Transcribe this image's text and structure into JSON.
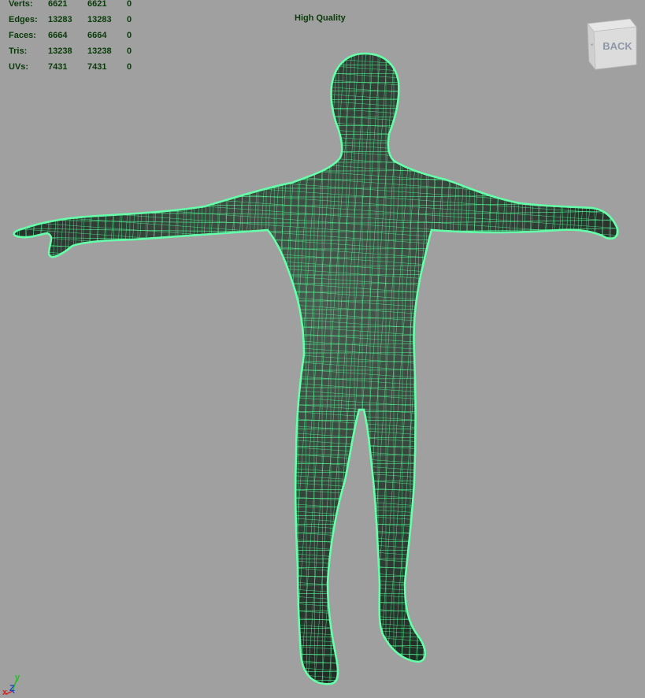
{
  "hud": {
    "rows": [
      {
        "label": "Verts:",
        "total": "6621",
        "selected": "6621",
        "extra": "0"
      },
      {
        "label": "Edges:",
        "total": "13283",
        "selected": "13283",
        "extra": "0"
      },
      {
        "label": "Faces:",
        "total": "6664",
        "selected": "6664",
        "extra": "0"
      },
      {
        "label": "Tris:",
        "total": "13238",
        "selected": "13238",
        "extra": "0"
      },
      {
        "label": "UVs:",
        "total": "7431",
        "selected": "7431",
        "extra": "0"
      }
    ],
    "quality_label": "High Quality"
  },
  "view_cube": {
    "face_label": "BACK"
  },
  "axis_gizmo": {
    "x_label": "x",
    "y_label": "y",
    "z_label": "Z",
    "x_color": "#d02020",
    "y_color": "#20c020",
    "z_color": "#2040d0"
  },
  "colors": {
    "background": "#a0a0a0",
    "hud_text": "#0a3a0a",
    "wire": "#55ff9a",
    "mesh_fill": "#2e3a33"
  }
}
